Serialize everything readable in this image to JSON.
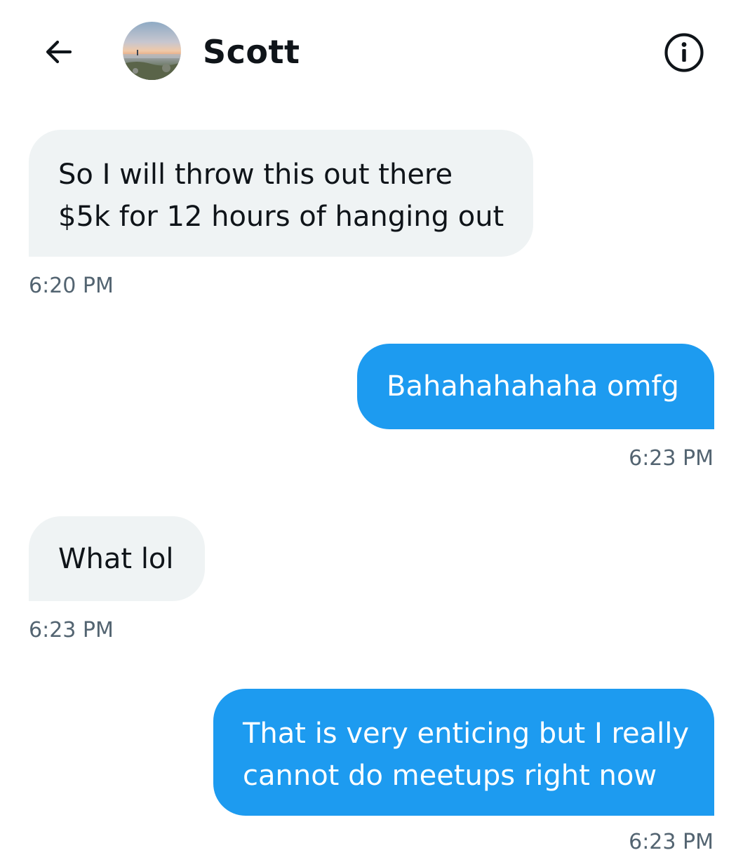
{
  "header": {
    "contact_name": "Scott",
    "back_icon": "arrow-left-icon",
    "info_icon": "info-circle-icon"
  },
  "messages": [
    {
      "direction": "incoming",
      "lines": [
        "So I will throw this out there",
        "$5k for 12 hours of hanging out"
      ],
      "time": "6:20 PM"
    },
    {
      "direction": "outgoing",
      "lines": [
        "Bahahahahaha omfg"
      ],
      "time": "6:23 PM"
    },
    {
      "direction": "incoming",
      "lines": [
        "What lol"
      ],
      "time": "6:23 PM"
    },
    {
      "direction": "outgoing",
      "lines": [
        "That is very enticing but I really",
        "cannot do meetups right now"
      ],
      "time": "6:23 PM"
    }
  ],
  "colors": {
    "incoming_bubble": "#eff3f4",
    "outgoing_bubble": "#1d9bf0",
    "timestamp": "#536471",
    "text": "#0f1419"
  }
}
